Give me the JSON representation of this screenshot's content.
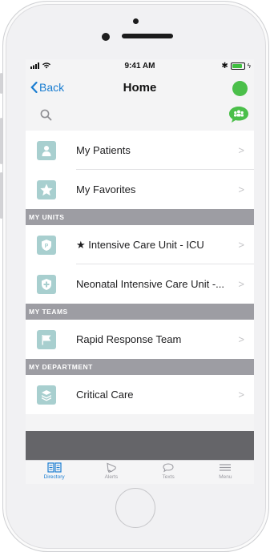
{
  "status_bar": {
    "time": "9:41 AM"
  },
  "nav": {
    "back_label": "Back",
    "title": "Home",
    "presence_color": "#4bbf4a"
  },
  "search": {
    "icon": "search-icon",
    "group_chat_icon": "group-chat-icon"
  },
  "colors": {
    "accent": "#1a7dd1",
    "tile": "#a8cfcf",
    "section_bg": "#9d9da3",
    "presence": "#4bbf4a"
  },
  "rows_top": [
    {
      "label": "My Patients",
      "icon": "patient-icon"
    },
    {
      "label": "My Favorites",
      "icon": "star-icon"
    }
  ],
  "sections": {
    "units": {
      "header": "MY UNITS",
      "rows": [
        {
          "label": "★ Intensive Care Unit - ICU",
          "icon": "unit-icon"
        },
        {
          "label": "Neonatal Intensive Care Unit -...",
          "icon": "unit-icon"
        }
      ]
    },
    "teams": {
      "header": "MY TEAMS",
      "rows": [
        {
          "label": "Rapid Response Team",
          "icon": "flag-icon"
        }
      ]
    },
    "department": {
      "header": "MY DEPARTMENT",
      "rows": [
        {
          "label": "Critical Care",
          "icon": "department-icon"
        }
      ]
    }
  },
  "chevron": ">",
  "tabs": [
    {
      "label": "Directory",
      "icon": "directory-icon",
      "active": true
    },
    {
      "label": "Alerts",
      "icon": "alerts-icon",
      "active": false
    },
    {
      "label": "Texts",
      "icon": "texts-icon",
      "active": false
    },
    {
      "label": "Menu",
      "icon": "menu-icon",
      "active": false
    }
  ]
}
